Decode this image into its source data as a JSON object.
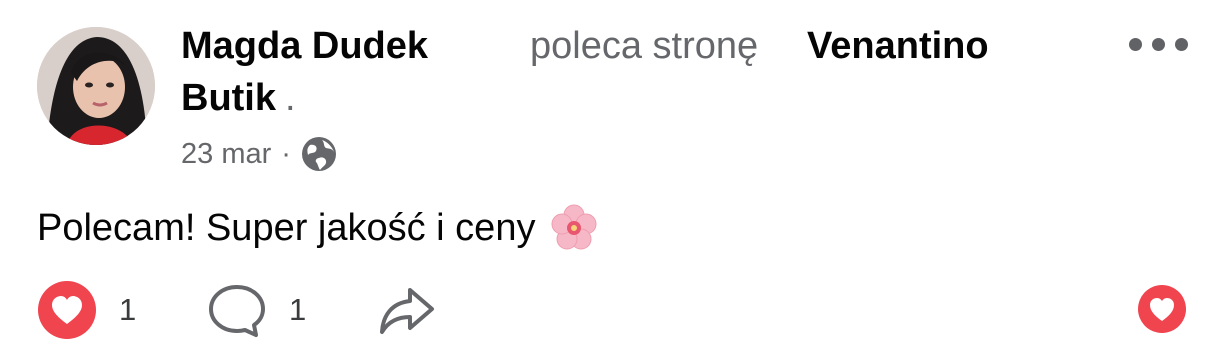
{
  "post": {
    "author": "Magda Dudek",
    "verb": "poleca stronę",
    "page_name_line1": "Venantino",
    "page_name_line2": "Butik",
    "trailing": ".",
    "date": "23 mar",
    "date_separator": "·",
    "privacy_icon": "globe-icon",
    "body_text": "Polecam! Super jakość i ceny",
    "body_emoji": "cherry-blossom-emoji",
    "reactions": {
      "like_count": "1",
      "comment_count": "1"
    },
    "colors": {
      "reaction_red": "#f0444f",
      "secondary_text": "#65676b"
    }
  }
}
